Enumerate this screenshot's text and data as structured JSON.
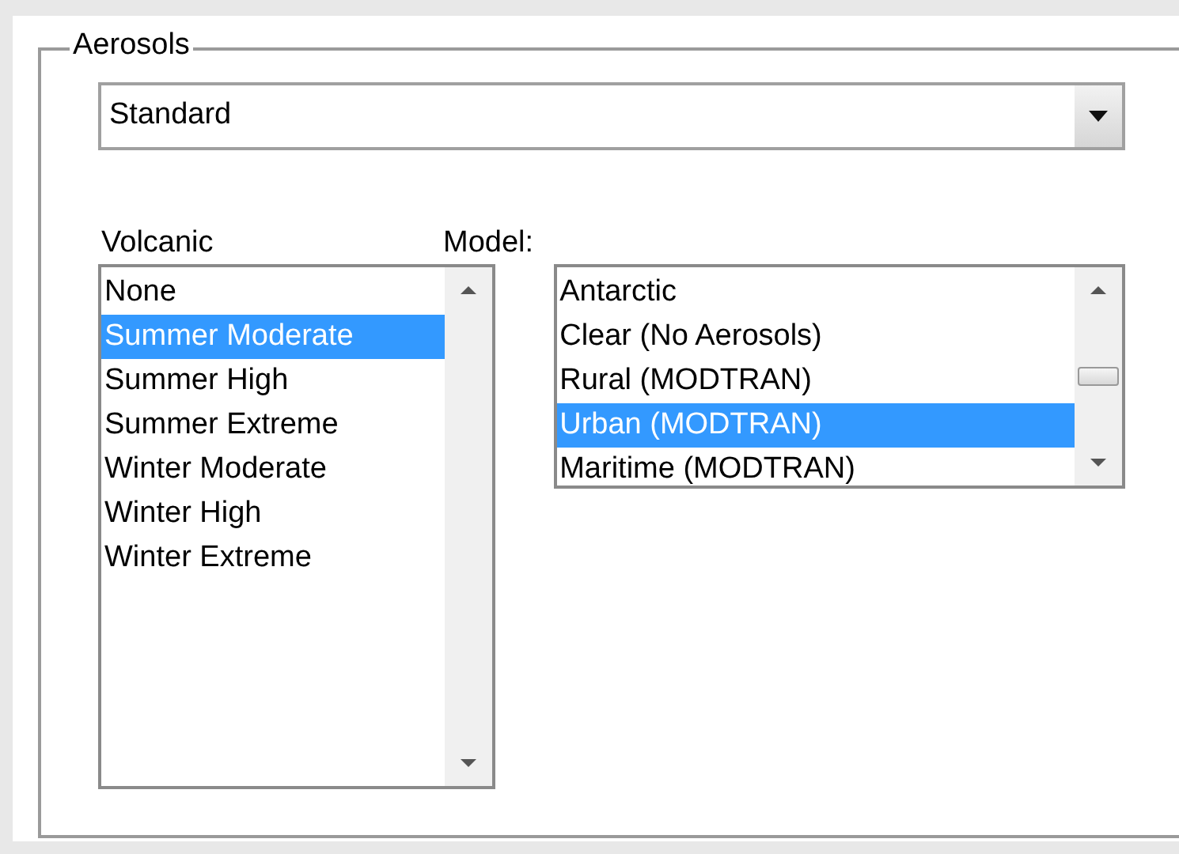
{
  "group": {
    "title": "Aerosols"
  },
  "dropdown": {
    "value": "Standard"
  },
  "volcanic": {
    "label": "Volcanic",
    "items": [
      {
        "label": "None",
        "selected": false
      },
      {
        "label": "Summer Moderate",
        "selected": true
      },
      {
        "label": "Summer High",
        "selected": false
      },
      {
        "label": "Summer Extreme",
        "selected": false
      },
      {
        "label": "Winter Moderate",
        "selected": false
      },
      {
        "label": "Winter High",
        "selected": false
      },
      {
        "label": "Winter Extreme",
        "selected": false
      }
    ]
  },
  "model": {
    "label": "Model:",
    "items": [
      {
        "label": "Antarctic",
        "selected": false
      },
      {
        "label": "Clear (No Aerosols)",
        "selected": false
      },
      {
        "label": "Rural (MODTRAN)",
        "selected": false
      },
      {
        "label": "Urban (MODTRAN)",
        "selected": true
      },
      {
        "label": "Maritime (MODTRAN)",
        "selected": false
      }
    ]
  }
}
